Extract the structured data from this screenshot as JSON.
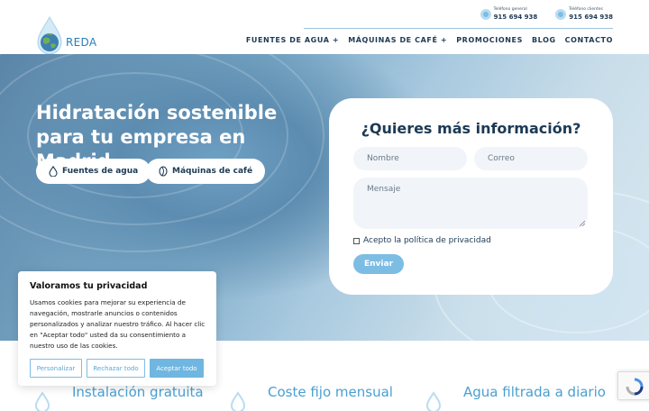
{
  "brand": {
    "name": "REDA"
  },
  "contact": [
    {
      "label": "Teléfono general",
      "number": "915 694 938"
    },
    {
      "label": "Teléfono clientes",
      "number": "915 694 938"
    }
  ],
  "nav": [
    {
      "label": "FUENTES DE AGUA +"
    },
    {
      "label": "MÁQUINAS DE CAFÉ +"
    },
    {
      "label": "PROMOCIONES"
    },
    {
      "label": "BLOG"
    },
    {
      "label": "CONTACTO"
    }
  ],
  "hero": {
    "title": "Hidratación sostenible para tu empresa en Madrid",
    "buttons": [
      {
        "label": "Fuentes de agua",
        "icon": "water-drop-icon"
      },
      {
        "label": "Máquinas de café",
        "icon": "coffee-bean-icon"
      }
    ]
  },
  "form": {
    "title": "¿Quieres más información?",
    "name_placeholder": "Nombre",
    "email_placeholder": "Correo",
    "message_placeholder": "Mensaje",
    "privacy_label": "Acepto la política de privacidad",
    "submit_label": "Enviar"
  },
  "cookies": {
    "title": "Valoramos tu privacidad",
    "text": "Usamos cookies para mejorar su experiencia de navegación, mostrarle anuncios o contenidos personalizados y analizar nuestro tráfico. Al hacer clic en \"Aceptar todo\" usted da su consentimiento a nuestro uso de las cookies.",
    "customize_label": "Personalizar",
    "reject_label": "Rechazar todo",
    "accept_label": "Aceptar todo"
  },
  "features": [
    {
      "label": "Instalación gratuita"
    },
    {
      "label": "Coste fijo mensual"
    },
    {
      "label": "Agua filtrada a diario"
    }
  ],
  "colors": {
    "accent": "#7dbde4",
    "navy": "#1c3a55",
    "feature_text": "#4a9fd1"
  }
}
